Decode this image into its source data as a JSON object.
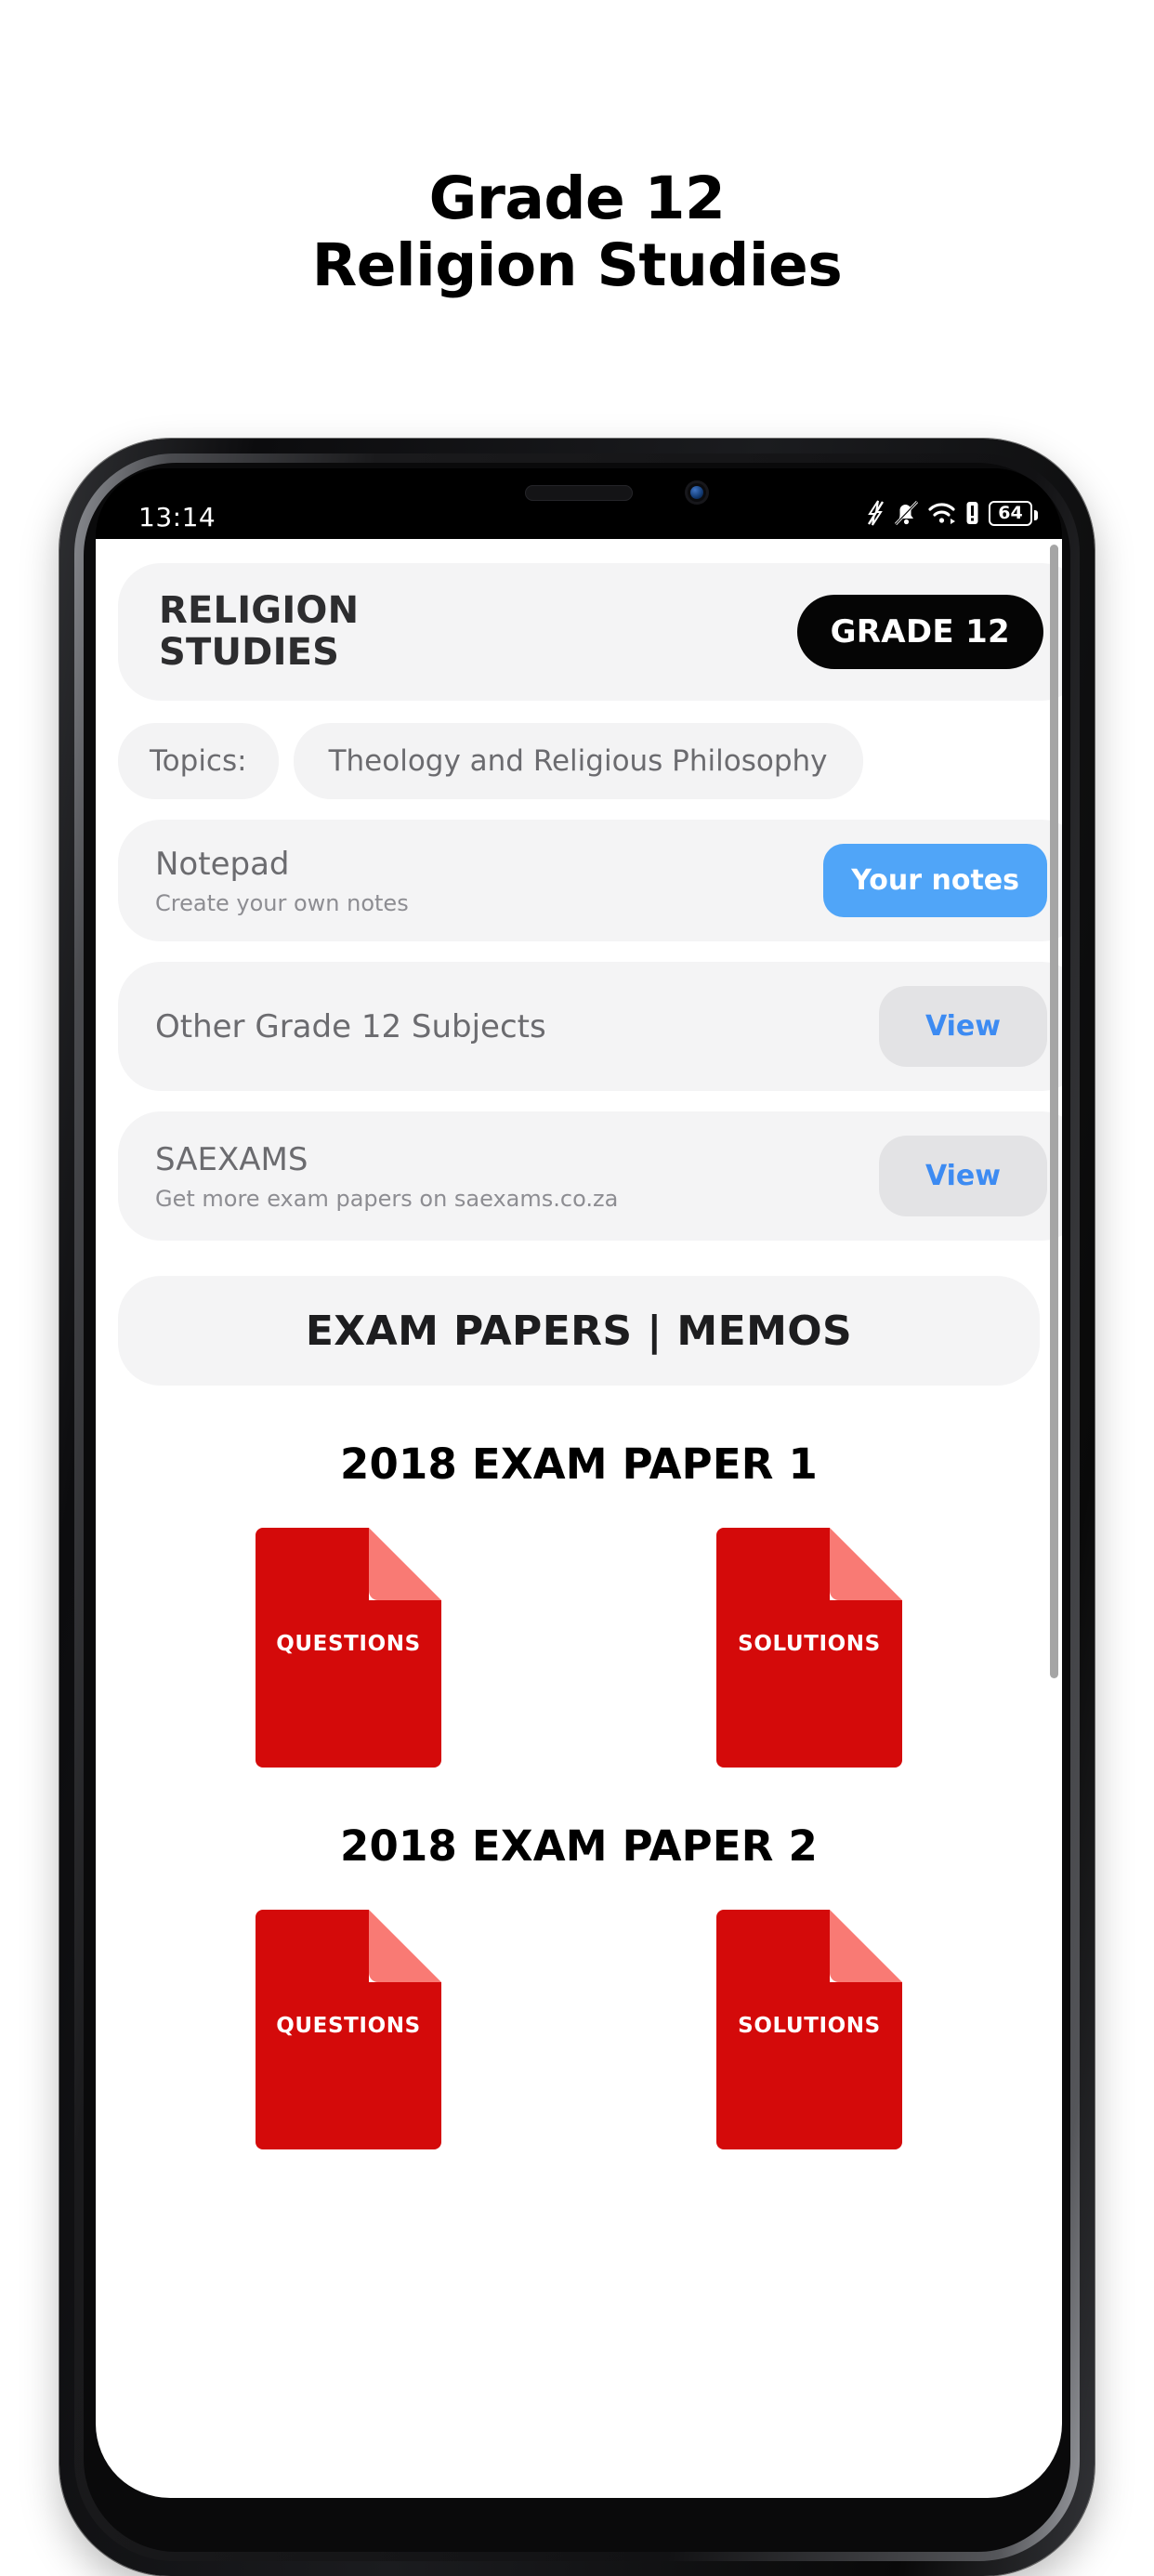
{
  "page": {
    "title_line1": "Grade 12",
    "title_line2": "Religion Studies"
  },
  "status_bar": {
    "time": "13:14",
    "battery_level": "64",
    "icons": [
      "flash-off-icon",
      "bell-off-icon",
      "wifi-icon",
      "alert-icon",
      "battery-icon"
    ]
  },
  "app": {
    "header": {
      "subject_line1": "RELIGION",
      "subject_line2": "STUDIES",
      "grade_badge": "GRADE 12"
    },
    "topics": {
      "label": "Topics:",
      "value": "Theology and Religious Philosophy"
    },
    "rows": [
      {
        "title": "Notepad",
        "subtitle": "Create your own notes",
        "action": "Your notes",
        "action_style": "blue"
      },
      {
        "title": "Other Grade 12 Subjects",
        "subtitle": "",
        "action": "View",
        "action_style": "grey"
      },
      {
        "title": "SAEXAMS",
        "subtitle": "Get more exam papers on saexams.co.za",
        "action": "View",
        "action_style": "grey"
      }
    ],
    "banner": "EXAM PAPERS | MEMOS",
    "papers": [
      {
        "title": "2018 EXAM PAPER 1",
        "questions_label": "QUESTIONS",
        "solutions_label": "SOLUTIONS"
      },
      {
        "title": "2018 EXAM PAPER 2",
        "questions_label": "QUESTIONS",
        "solutions_label": "SOLUTIONS"
      }
    ]
  },
  "colors": {
    "accent_blue": "#50a5f8",
    "link_blue": "#3d8bf2",
    "doc_red": "#d40a0a",
    "doc_fold": "#f97a74",
    "card_grey": "#f4f4f5",
    "badge_black": "#050505"
  }
}
